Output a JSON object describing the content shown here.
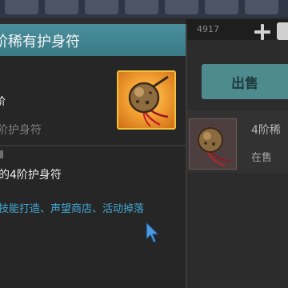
{
  "tooltip": {
    "title": "阶稀有护身符",
    "tier": "阶",
    "category": "阶护身符",
    "description": "的4阶护身符",
    "sources": "技能打造、声望商店、活动掉落",
    "icon": "amulet-icon"
  },
  "currency": {
    "value": "4917",
    "add_icon": "plus-icon"
  },
  "market": {
    "sell_label": "出售",
    "listing": {
      "name": "4阶稀",
      "status": "在售",
      "icon": "amulet-icon"
    }
  },
  "colors": {
    "header_teal": "#4a8f9c",
    "source_blue": "#43a9d6",
    "icon_gold_border": "#f1c03d"
  }
}
